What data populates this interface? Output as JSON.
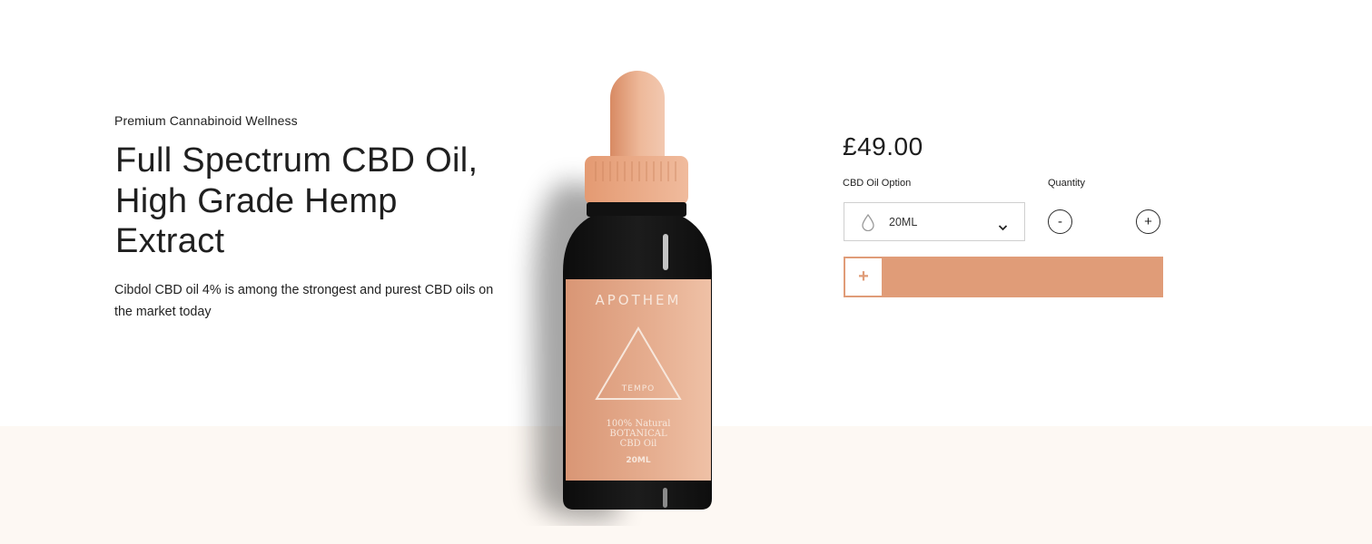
{
  "hero": {
    "eyebrow": "Premium Cannabinoid Wellness",
    "title": "Full Spectrum CBD Oil, High Grade Hemp Extract",
    "description": "Cibdol CBD oil 4% is among the strongest and purest CBD oils on the market today"
  },
  "product_image": {
    "brand": "APOTHEM",
    "variant": "TEMPO",
    "label_line1": "100% Natural",
    "label_line2": "BOTANICAL",
    "label_line3": "CBD Oil",
    "volume": "20ML"
  },
  "purchase": {
    "price": "£49.00",
    "option_label": "CBD Oil Option",
    "option_selected": "20ML",
    "quantity_label": "Quantity",
    "decrement_symbol": "-",
    "increment_symbol": "+",
    "add_symbol": "+",
    "add_label": ""
  },
  "colors": {
    "accent": "#e09c78",
    "band": "#fdf8f3",
    "bottle": "#141414",
    "label": "#e3a786"
  }
}
